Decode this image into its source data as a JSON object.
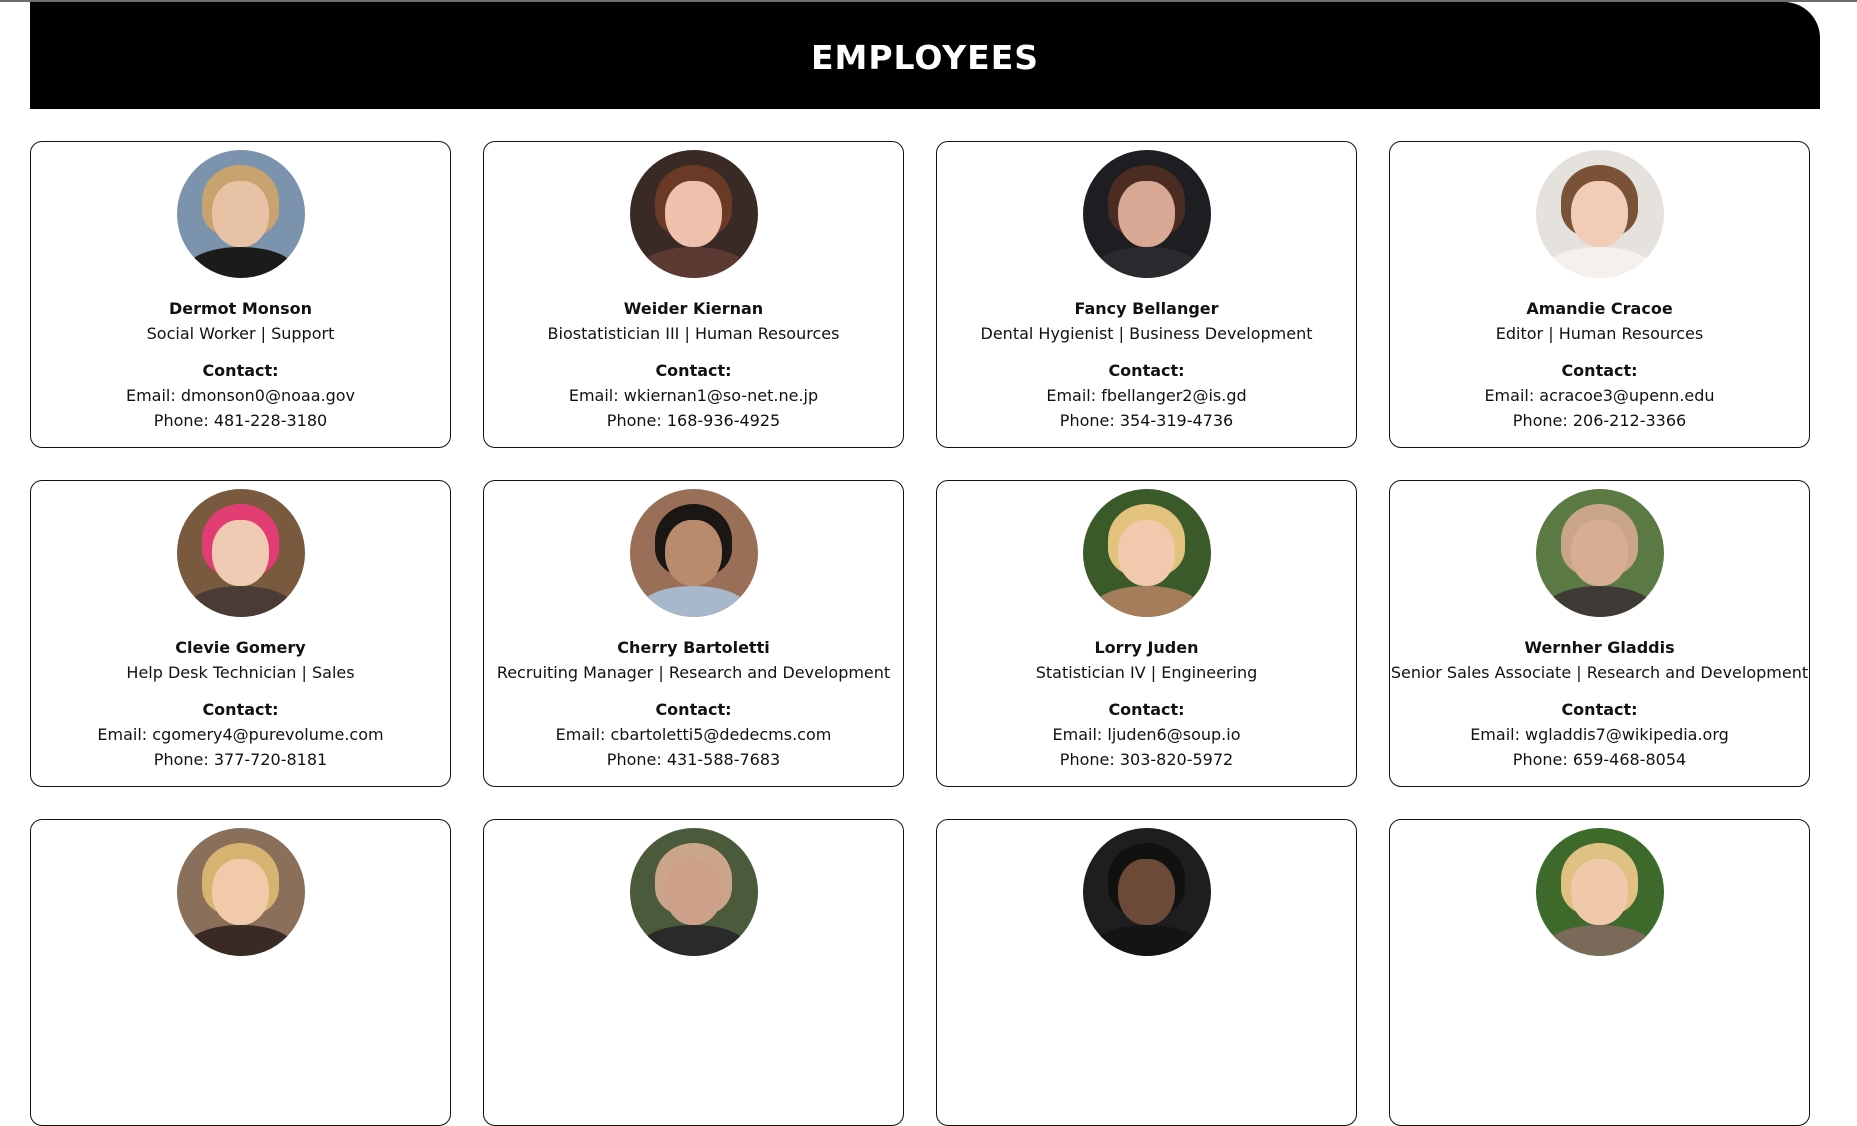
{
  "page": {
    "title": "EMPLOYEES"
  },
  "employees": [
    {
      "name": "Dermot Monson",
      "role": "Social Worker | Support",
      "contact_label": "Contact:",
      "email": "Email: dmonson0@noaa.gov",
      "phone": "Phone: 481-228-3180",
      "avatar_colors": {
        "bg": "#7c93ad",
        "hair": "#c7a46f",
        "skin": "#e8c2a4",
        "body": "#1b1b1b"
      }
    },
    {
      "name": "Weider Kiernan",
      "role": "Biostatistician III | Human Resources",
      "contact_label": "Contact:",
      "email": "Email: wkiernan1@so-net.ne.jp",
      "phone": "Phone: 168-936-4925",
      "avatar_colors": {
        "bg": "#3a2a26",
        "hair": "#6b3a27",
        "skin": "#efc1ad",
        "body": "#5b3a34"
      }
    },
    {
      "name": "Fancy Bellanger",
      "role": "Dental Hygienist | Business Development",
      "contact_label": "Contact:",
      "email": "Email: fbellanger2@is.gd",
      "phone": "Phone: 354-319-4736",
      "avatar_colors": {
        "bg": "#1e1e22",
        "hair": "#4a2c22",
        "skin": "#d9a894",
        "body": "#2a2a2e"
      }
    },
    {
      "name": "Amandie Cracoe",
      "role": "Editor | Human Resources",
      "contact_label": "Contact:",
      "email": "Email: acracoe3@upenn.edu",
      "phone": "Phone: 206-212-3366",
      "avatar_colors": {
        "bg": "#e5e1dc",
        "hair": "#7a5238",
        "skin": "#f1cdb8",
        "body": "#f4f1ec"
      }
    },
    {
      "name": "Clevie Gomery",
      "role": "Help Desk Technician | Sales",
      "contact_label": "Contact:",
      "email": "Email: cgomery4@purevolume.com",
      "phone": "Phone: 377-720-8181",
      "avatar_colors": {
        "bg": "#7a5a3e",
        "hair": "#e23d73",
        "skin": "#f0cbb4",
        "body": "#4a3b36"
      }
    },
    {
      "name": "Cherry Bartoletti",
      "role": "Recruiting Manager | Research and Development",
      "contact_label": "Contact:",
      "email": "Email: cbartoletti5@dedecms.com",
      "phone": "Phone: 431-588-7683",
      "avatar_colors": {
        "bg": "#9a6f57",
        "hair": "#1a1614",
        "skin": "#b98a6b",
        "body": "#a8b8cc"
      }
    },
    {
      "name": "Lorry Juden",
      "role": "Statistician IV | Engineering",
      "contact_label": "Contact:",
      "email": "Email: ljuden6@soup.io",
      "phone": "Phone: 303-820-5972",
      "avatar_colors": {
        "bg": "#3b5a2a",
        "hair": "#e2c27c",
        "skin": "#f1c9ad",
        "body": "#a57d5a"
      }
    },
    {
      "name": "Wernher Gladdis",
      "role": "Senior Sales Associate | Research and Development",
      "contact_label": "Contact:",
      "email": "Email: wgladdis7@wikipedia.org",
      "phone": "Phone: 659-468-8054",
      "avatar_colors": {
        "bg": "#5b7a44",
        "hair": "#caa58a",
        "skin": "#d8ae92",
        "body": "#3f3a36"
      }
    },
    {
      "name": "",
      "role": "",
      "contact_label": "",
      "email": "",
      "phone": "",
      "avatar_colors": {
        "bg": "#8a6f5a",
        "hair": "#d7b372",
        "skin": "#f1caa9",
        "body": "#3a2a26"
      }
    },
    {
      "name": "",
      "role": "",
      "contact_label": "",
      "email": "",
      "phone": "",
      "avatar_colors": {
        "bg": "#4a5a3a",
        "hair": "#caa58a",
        "skin": "#cda08a",
        "body": "#2a2a2a"
      }
    },
    {
      "name": "",
      "role": "",
      "contact_label": "",
      "email": "",
      "phone": "",
      "avatar_colors": {
        "bg": "#1e1e1e",
        "hair": "#111111",
        "skin": "#6b4a38",
        "body": "#141414"
      }
    },
    {
      "name": "",
      "role": "",
      "contact_label": "",
      "email": "",
      "phone": "",
      "avatar_colors": {
        "bg": "#3d6a2b",
        "hair": "#dfc283",
        "skin": "#f0c8aa",
        "body": "#7b6a5a"
      }
    }
  ]
}
